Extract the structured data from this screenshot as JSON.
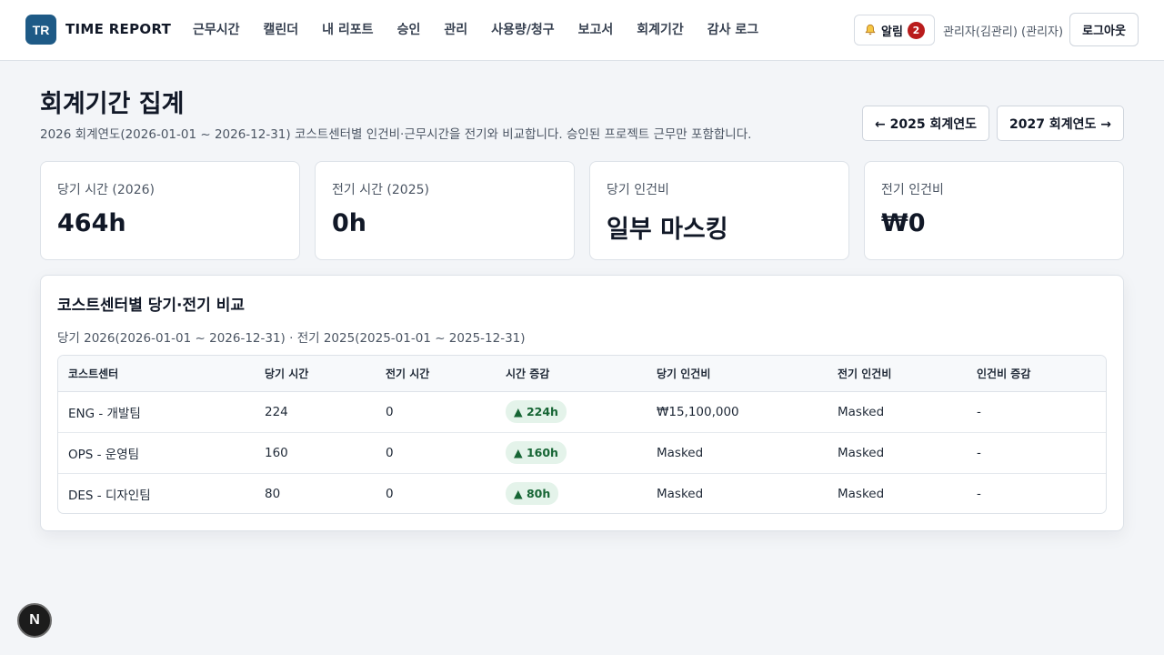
{
  "header": {
    "logo_mark": "TR",
    "app_name": "TIME REPORT",
    "nav": [
      "근무시간",
      "캘린더",
      "내 리포트",
      "승인",
      "관리",
      "사용량/청구",
      "보고서",
      "회계기간",
      "감사 로그"
    ],
    "alarm_label": "알림",
    "alarm_count": "2",
    "user": "관리자(김관리) (관리자)",
    "logout": "로그아웃"
  },
  "page": {
    "title": "회계기간 집계",
    "description": "2026 회계연도(2026-01-01 ~ 2026-12-31) 코스트센터별 인건비·근무시간을 전기와 비교합니다. 승인된 프로젝트 근무만 포함합니다.",
    "prev_year": "← 2025 회계연도",
    "next_year": "2027 회계연도 →"
  },
  "stats": [
    {
      "label": "당기 시간 (2026)",
      "value": "464h"
    },
    {
      "label": "전기 시간 (2025)",
      "value": "0h"
    },
    {
      "label": "당기 인건비",
      "value": "일부 마스킹"
    },
    {
      "label": "전기 인건비",
      "value": "₩0"
    }
  ],
  "comparison": {
    "title": "코스트센터별 당기·전기 비교",
    "subtitle": "당기 2026(2026-01-01 ~ 2026-12-31) · 전기 2025(2025-01-01 ~ 2025-12-31)",
    "columns": [
      "코스트센터",
      "당기 시간",
      "전기 시간",
      "시간 증감",
      "당기 인건비",
      "전기 인건비",
      "인건비 증감"
    ],
    "rows": [
      {
        "center": "ENG - 개발팀",
        "cur_hours": "224",
        "prev_hours": "0",
        "delta": "▲ 224h",
        "cur_cost": "₩15,100,000",
        "prev_cost": "Masked",
        "cost_delta": "-"
      },
      {
        "center": "OPS - 운영팀",
        "cur_hours": "160",
        "prev_hours": "0",
        "delta": "▲ 160h",
        "cur_cost": "Masked",
        "prev_cost": "Masked",
        "cost_delta": "-"
      },
      {
        "center": "DES - 디자인팀",
        "cur_hours": "80",
        "prev_hours": "0",
        "delta": "▲ 80h",
        "cur_cost": "Masked",
        "prev_cost": "Masked",
        "cost_delta": "-"
      }
    ]
  },
  "fab_label": "N",
  "colors": {
    "brand": "#1e5a86",
    "badge": "#b91c1c",
    "positive_bg": "#e4f3ea",
    "positive_text": "#166534"
  }
}
